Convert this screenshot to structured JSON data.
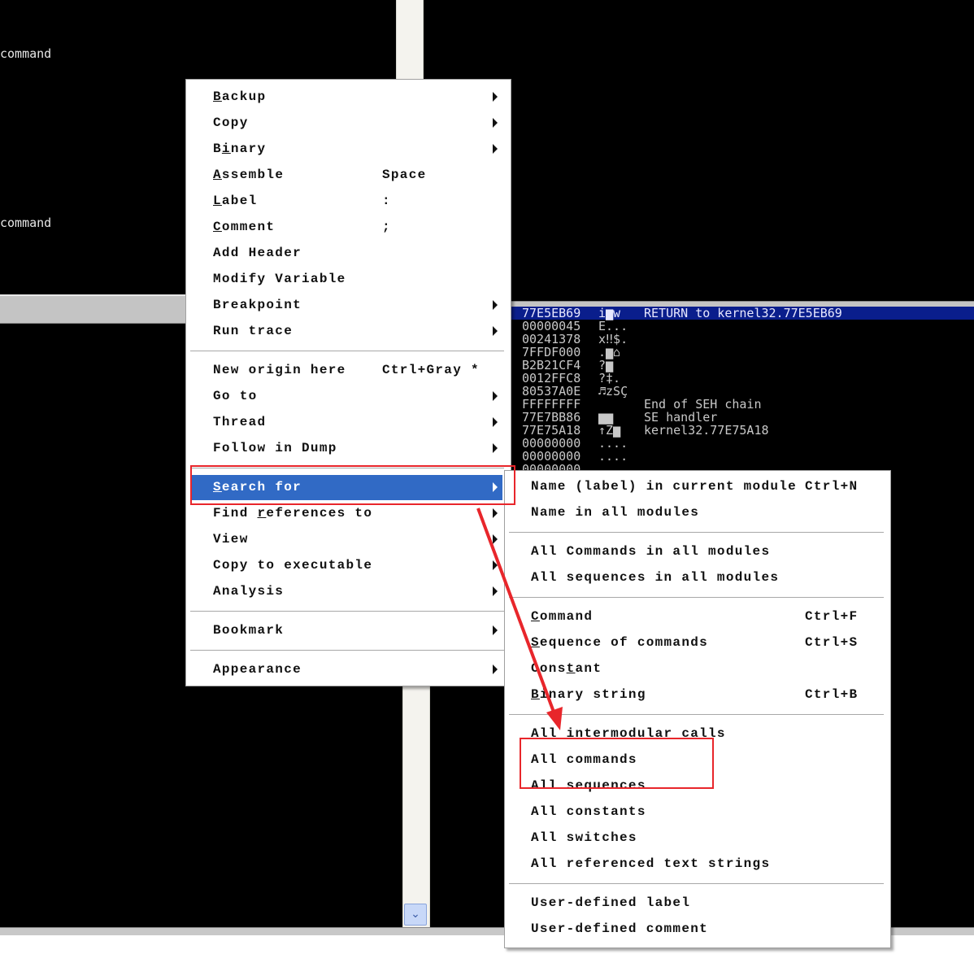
{
  "colors": {
    "menu_highlight": "#316ac5",
    "annotation_red": "#e8262b",
    "stack_selected": "#0a1e8c"
  },
  "disasm_pane": {
    "lines": [
      "command",
      "command"
    ]
  },
  "stack_pane": {
    "rows": [
      {
        "addr": "77E5EB69",
        "ascii": "i▆w",
        "comment": "RETURN to kernel32.77E5EB69",
        "selected": true
      },
      {
        "addr": "00000045",
        "ascii": "E...",
        "comment": ""
      },
      {
        "addr": "00241378",
        "ascii": "x‼$.",
        "comment": ""
      },
      {
        "addr": "7FFDF000",
        "ascii": ".▆⌂",
        "comment": ""
      },
      {
        "addr": "B2B21CF4",
        "ascii": "?▆",
        "comment": ""
      },
      {
        "addr": "0012FFC8",
        "ascii": "?‡.",
        "comment": ""
      },
      {
        "addr": "80537A0E",
        "ascii": "♬zSÇ",
        "comment": ""
      },
      {
        "addr": "FFFFFFFF",
        "ascii": "",
        "comment": "End of SEH chain"
      },
      {
        "addr": "77E7BB86",
        "ascii": "▆▆",
        "comment": "SE handler"
      },
      {
        "addr": "77E75A18",
        "ascii": "↑Z▆",
        "comment": "kernel32.77E75A18"
      },
      {
        "addr": "00000000",
        "ascii": "....",
        "comment": ""
      },
      {
        "addr": "00000000",
        "ascii": "....",
        "comment": ""
      },
      {
        "addr": "00000000",
        "ascii": "",
        "comment": ""
      }
    ]
  },
  "context_menu": {
    "items": [
      {
        "label": "Backup",
        "mnemonic": "B",
        "submenu": true
      },
      {
        "label": "Copy",
        "submenu": true
      },
      {
        "label": "Binary",
        "mnemonic": "i",
        "submenu": true
      },
      {
        "label": "Assemble",
        "mnemonic": "A",
        "shortcut": "Space"
      },
      {
        "label": "Label",
        "mnemonic": "L",
        "shortcut": ":"
      },
      {
        "label": "Comment",
        "mnemonic": "C",
        "shortcut": ";"
      },
      {
        "label": "Add Header"
      },
      {
        "label": "Modify Variable"
      },
      {
        "label": "Breakpoint",
        "submenu": true
      },
      {
        "label": "Run trace",
        "submenu": true
      },
      {
        "separator": true
      },
      {
        "label": "New origin here",
        "shortcut": "Ctrl+Gray *"
      },
      {
        "label": "Go to",
        "submenu": true
      },
      {
        "label": "Thread",
        "submenu": true
      },
      {
        "label": "Follow in Dump",
        "submenu": true
      },
      {
        "separator": true
      },
      {
        "label": "Search for",
        "mnemonic": "S",
        "submenu": true,
        "highlighted": true
      },
      {
        "label": "Find references to",
        "mnemonic": "r",
        "submenu": true
      },
      {
        "label": "View",
        "submenu": true
      },
      {
        "label": "Copy to executable",
        "submenu": true
      },
      {
        "label": "Analysis",
        "submenu": true
      },
      {
        "separator": true
      },
      {
        "label": "Bookmark",
        "submenu": true
      },
      {
        "separator": true
      },
      {
        "label": "Appearance",
        "submenu": true
      }
    ]
  },
  "search_submenu": {
    "items": [
      {
        "label": "Name (label) in current module",
        "shortcut": "Ctrl+N"
      },
      {
        "label": "Name in all modules"
      },
      {
        "separator": true
      },
      {
        "label": "All Commands in all modules"
      },
      {
        "label": "All sequences in all modules"
      },
      {
        "separator": true
      },
      {
        "label": "Command",
        "mnemonic": "C",
        "shortcut": "Ctrl+F"
      },
      {
        "label": "Sequence of commands",
        "mnemonic": "S",
        "shortcut": "Ctrl+S"
      },
      {
        "label": "Constant",
        "mnemonic": "t"
      },
      {
        "label": "Binary string",
        "mnemonic": "B",
        "shortcut": "Ctrl+B"
      },
      {
        "separator": true
      },
      {
        "label": "All intermodular calls"
      },
      {
        "label": "All commands"
      },
      {
        "label": "All sequences"
      },
      {
        "label": "All constants"
      },
      {
        "label": "All switches"
      },
      {
        "label": "All referenced text strings"
      },
      {
        "separator": true
      },
      {
        "label": "User-defined label"
      },
      {
        "label": "User-defined comment"
      }
    ]
  },
  "icons": {
    "scroll_down": "chevron-down-icon",
    "submenu_arrow": "triangle-right-icon",
    "annotation_arrow": "red-arrow"
  }
}
